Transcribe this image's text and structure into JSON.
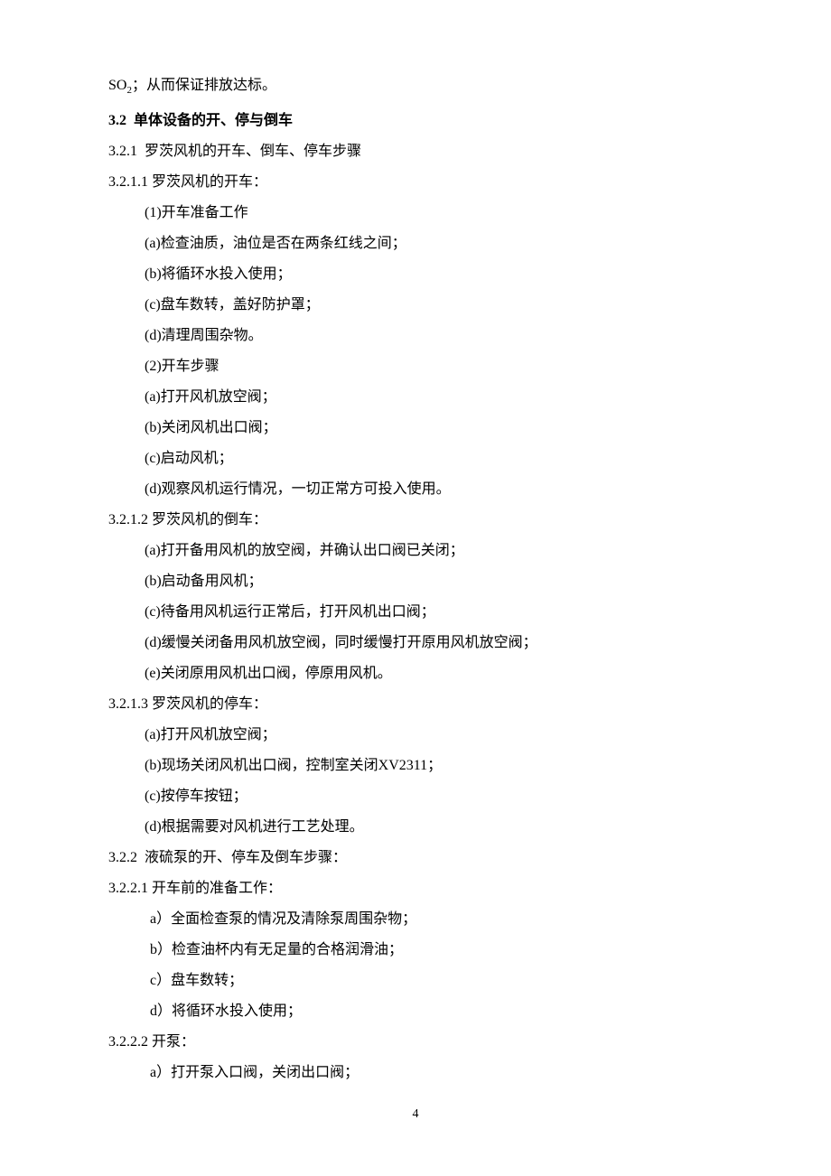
{
  "header_prefix": "SO",
  "header_sub": "2",
  "header_suffix": "；从而保证排放达标。",
  "section_3_2_title": "3.2  单体设备的开、停与倒车",
  "s3_2_1": "3.2.1  罗茨风机的开车、倒车、停车步骤",
  "s3_2_1_1": "3.2.1.1 罗茨风机的开车：",
  "s3_2_1_1_items": [
    "(1)开车准备工作",
    "(a)检查油质，油位是否在两条红线之间；",
    "(b)将循环水投入使用；",
    "(c)盘车数转，盖好防护罩；",
    "(d)清理周围杂物。",
    "(2)开车步骤",
    "(a)打开风机放空阀；",
    "(b)关闭风机出口阀；",
    "(c)启动风机；",
    "(d)观察风机运行情况，一切正常方可投入使用。"
  ],
  "s3_2_1_2": "3.2.1.2 罗茨风机的倒车：",
  "s3_2_1_2_items": [
    "(a)打开备用风机的放空阀，并确认出口阀已关闭；",
    "(b)启动备用风机；",
    "(c)待备用风机运行正常后，打开风机出口阀；",
    "(d)缓慢关闭备用风机放空阀，同时缓慢打开原用风机放空阀；",
    "(e)关闭原用风机出口阀，停原用风机。"
  ],
  "s3_2_1_3": "3.2.1.3 罗茨风机的停车：",
  "s3_2_1_3_items": [
    "(a)打开风机放空阀；",
    "(b)现场关闭风机出口阀，控制室关闭XV2311；",
    "(c)按停车按钮；",
    "(d)根据需要对风机进行工艺处理。"
  ],
  "s3_2_2": "3.2.2  液硫泵的开、停车及倒车步骤：",
  "s3_2_2_1": "3.2.2.1 开车前的准备工作：",
  "s3_2_2_1_items": [
    "a）全面检查泵的情况及清除泵周围杂物；",
    "b）检查油杯内有无足量的合格润滑油；",
    "c）盘车数转；",
    "d）将循环水投入使用；"
  ],
  "s3_2_2_2": "3.2.2.2 开泵：",
  "s3_2_2_2_items": [
    "a）打开泵入口阀，关闭出口阀；"
  ],
  "page_number": "4"
}
